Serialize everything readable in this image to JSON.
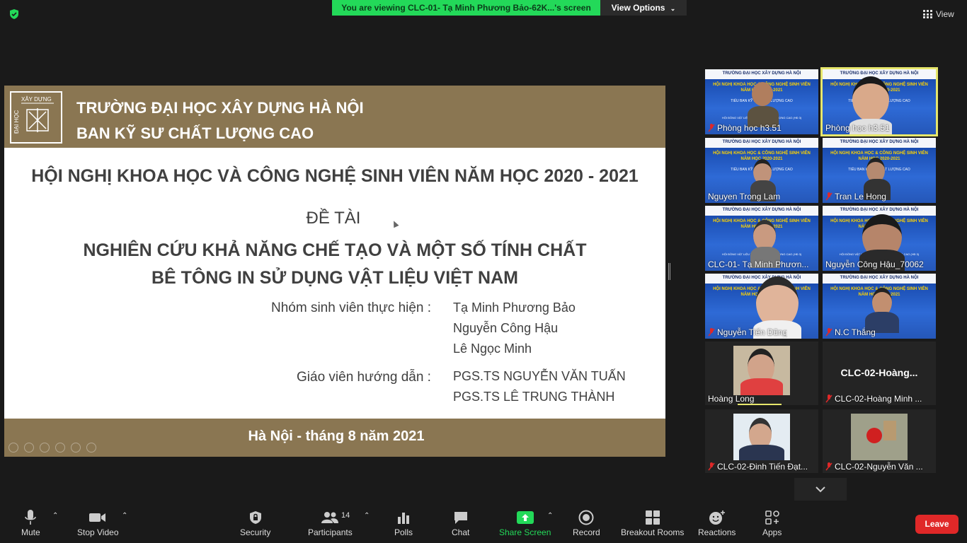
{
  "topbar": {
    "viewing_banner": "You are viewing CLC-01- Tạ Minh Phương Bảo-62K...'s screen",
    "view_options": "View Options",
    "view_button": "View"
  },
  "slide": {
    "school_line1": "TRƯỜNG ĐẠI HỌC XÂY DỰNG HÀ NỘI",
    "school_line2": "BAN KỸ SƯ CHẤT LƯỢNG CAO",
    "logo_text_top": "XÂY DỰNG",
    "logo_text_side": "ĐẠI HỌC",
    "conference_title": "HỘI NGHỊ KHOA HỌC VÀ CÔNG NGHỆ SINH VIÊN NĂM HỌC 2020 - 2021",
    "topic_label": "ĐỀ TÀI",
    "topic_line1": "NGHIÊN CỨU KHẢ NĂNG CHẾ TẠO VÀ MỘT SỐ TÍNH CHẤT",
    "topic_line2": "BÊ TÔNG IN SỬ DỤNG VẬT LIỆU VIỆT NAM",
    "students_label": "Nhóm sinh viên thực hiện :",
    "students": [
      "Tạ Minh Phương Bảo",
      "Nguyễn Công Hậu",
      "Lê Ngọc Minh"
    ],
    "advisors_label": "Giáo viên hướng dẫn :",
    "advisors": [
      "PGS.TS NGUYỄN VĂN TUẤN",
      "PGS.TS LÊ TRUNG THÀNH"
    ],
    "footer": "Hà Nội - tháng 8 năm 2021"
  },
  "tile_slide_text": {
    "line1": "TRƯỜNG ĐẠI HỌC XÂY DỰNG HÀ NỘI",
    "line2a": "HỘI NGHỊ KHOA HỌC & CÔNG NGHỆ SINH VIÊN",
    "line2b": "NĂM HỌC 2020-2021",
    "line3": "TIỂU BAN KỸ SƯ CHẤT LƯỢNG CAO",
    "line4": "HỘI ĐỒNG VẬT LIỆU XÂY DỰNG CHẤT LƯỢNG CAO (HĐ 3)"
  },
  "participants": [
    {
      "name": "Phòng học h3.51",
      "muted": true
    },
    {
      "name": "Phòng học h3.51",
      "muted": false
    },
    {
      "name": "Nguyen Trong Lam",
      "muted": false
    },
    {
      "name": "Tran Le Hong",
      "muted": true
    },
    {
      "name": "CLC-01- Tạ Minh Phươn...",
      "muted": false
    },
    {
      "name": "Nguyễn Công Hậu_70062",
      "muted": false
    },
    {
      "name": "Nguyễn Tiến Dũng",
      "muted": true
    },
    {
      "name": "N.C Thắng",
      "muted": true
    },
    {
      "name": "Hoàng Long",
      "muted": false
    },
    {
      "name": "CLC-02-Hoàng Minh ...",
      "muted": true,
      "display": "CLC-02-Hoàng..."
    },
    {
      "name": "CLC-02-Đinh Tiến Đạt...",
      "muted": true
    },
    {
      "name": "CLC-02-Nguyễn Văn ...",
      "muted": true
    }
  ],
  "toolbar": {
    "mute": "Mute",
    "stop_video": "Stop Video",
    "security": "Security",
    "participants": "Participants",
    "participants_count": "14",
    "polls": "Polls",
    "chat": "Chat",
    "share_screen": "Share Screen",
    "record": "Record",
    "breakout_rooms": "Breakout Rooms",
    "reactions": "Reactions",
    "apps": "Apps",
    "leave": "Leave"
  },
  "colors": {
    "accent_green": "#23d959",
    "slide_brown": "#8a7652",
    "leave_red": "#e02828",
    "active_speaker": "#e6e66b"
  }
}
